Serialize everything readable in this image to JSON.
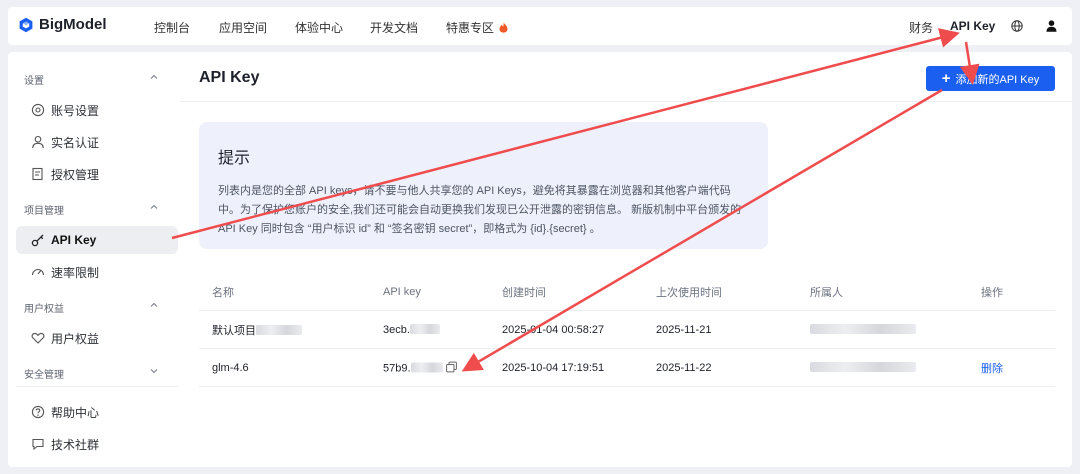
{
  "brand": {
    "name": "BigModel",
    "color": "#1a5ff0"
  },
  "topnav": {
    "items": [
      "控制台",
      "应用空间",
      "体验中心",
      "开发文档",
      "特惠专区"
    ],
    "right": {
      "finance": "财务",
      "api_key": "API Key"
    },
    "icons": [
      "fire-icon",
      "globe-icon",
      "user-icon"
    ]
  },
  "sidebar": {
    "sections": [
      {
        "title": "设置",
        "items": [
          {
            "label": "账号设置",
            "icon": "gear-icon"
          },
          {
            "label": "实名认证",
            "icon": "person-icon"
          },
          {
            "label": "授权管理",
            "icon": "document-icon"
          }
        ]
      },
      {
        "title": "项目管理",
        "items": [
          {
            "label": "API Key",
            "icon": "key-icon",
            "active": true
          },
          {
            "label": "速率限制",
            "icon": "gauge-icon"
          }
        ]
      },
      {
        "title": "用户权益",
        "items": [
          {
            "label": "用户权益",
            "icon": "heart-icon"
          }
        ]
      },
      {
        "title": "安全管理",
        "items": []
      }
    ],
    "bottom": [
      {
        "label": "帮助中心",
        "icon": "help-icon"
      },
      {
        "label": "技术社群",
        "icon": "chat-icon"
      }
    ]
  },
  "main": {
    "title": "API Key",
    "add_button": "添加新的API Key",
    "tip": {
      "title": "提示",
      "body": "列表内是您的全部 API keys，请不要与他人共享您的 API Keys，避免将其暴露在浏览器和其他客户端代码中。为了保护您账户的安全,我们还可能会自动更换我们发现已公开泄露的密钥信息。 新版机制中平台颁发的 API Key 同时包含 “用户标识 id” 和 “签名密钥 secret”，即格式为 {id}.{secret} 。"
    },
    "table": {
      "columns": [
        "名称",
        "API key",
        "创建时间",
        "上次使用时间",
        "所属人",
        "操作"
      ],
      "rows": [
        {
          "name": "默认项目",
          "key": "3ecb.",
          "created": "2025-01-04 00:58:27",
          "last_used": "2025-11-21",
          "owner": "",
          "action": ""
        },
        {
          "name": "glm-4.6",
          "key": "57b9.",
          "created": "2025-10-04 17:19:51",
          "last_used": "2025-11-22",
          "owner": "",
          "action": "删除"
        }
      ]
    }
  },
  "annotation_color": "#ef4d4d"
}
